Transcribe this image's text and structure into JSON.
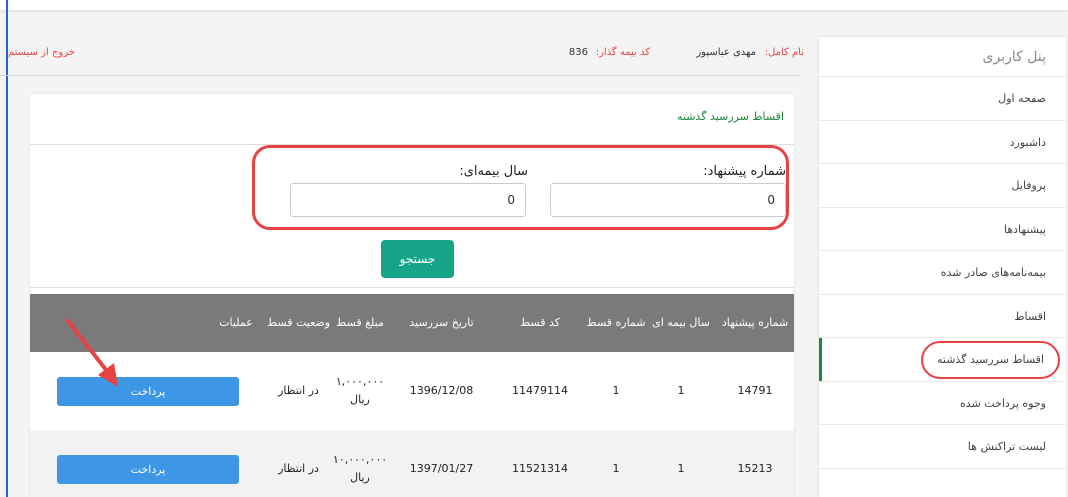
{
  "sidebar": {
    "title": "پنل کاربری",
    "items": [
      {
        "label": "صفحه اول"
      },
      {
        "label": "داشبورد"
      },
      {
        "label": "پروفایل"
      },
      {
        "label": "پیشنهادها"
      },
      {
        "label": "بیمه‌نامه‌های صادر شده"
      },
      {
        "label": "اقساط"
      },
      {
        "label": "اقساط سررسید گذشته"
      },
      {
        "label": "وجوه پرداخت شده"
      },
      {
        "label": "لیست تراکنش ها"
      }
    ]
  },
  "header": {
    "name_label": "نام کامل:",
    "name_value": "مهدی عباسپور",
    "code_label": "کد بیمه گذار:",
    "code_value": "836",
    "logout": "خروج از سیستم"
  },
  "card": {
    "title": "اقساط سررسید گذشته",
    "proposal_label": "شماره پیشنهاد:",
    "proposal_value": "0",
    "year_label": "سال بیمه‌ای:",
    "year_value": "0",
    "search_button": "جستجو"
  },
  "table": {
    "headers": {
      "proposal_no": "شماره پیشنهاد",
      "policy_year": "سال بیمه ای",
      "installment_no": "شماره قسط",
      "installment_code": "کد قسط",
      "due_date": "تاریخ سررسید",
      "amount": "مبلغ قسط",
      "status": "وضعیت قسط",
      "operations": "عملیات"
    },
    "rows": [
      {
        "proposal_no": "14791",
        "policy_year": "1",
        "installment_no": "1",
        "installment_code": "11479114",
        "due_date": "1396/12/08",
        "amount": "۱,۰۰۰,۰۰۰",
        "currency": "ریال",
        "status": "در انتظار",
        "action": "پرداخت"
      },
      {
        "proposal_no": "15213",
        "policy_year": "1",
        "installment_no": "1",
        "installment_code": "11521314",
        "due_date": "1397/01/27",
        "amount": "۱۰,۰۰۰,۰۰۰",
        "currency": "ریال",
        "status": "در انتظار",
        "action": "پرداخت"
      }
    ]
  },
  "colors": {
    "accent_green": "#1b8a3a",
    "button_teal": "#17a589",
    "pay_blue": "#3d97e6",
    "annotation_red": "#e74343",
    "header_gray": "#7a7a7a"
  }
}
